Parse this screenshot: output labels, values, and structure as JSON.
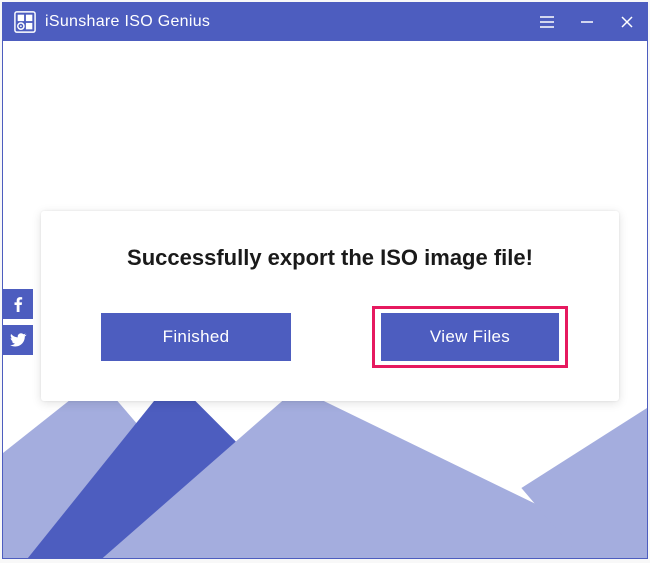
{
  "app": {
    "title": "iSunshare ISO Genius"
  },
  "dialog": {
    "message": "Successfully export the ISO image file!",
    "finished_label": "Finished",
    "view_files_label": "View Files"
  },
  "colors": {
    "primary": "#4d5dbf",
    "highlight": "#e6195f",
    "mountain_light": "#a4adde",
    "mountain_dark": "#4d5dbf"
  }
}
